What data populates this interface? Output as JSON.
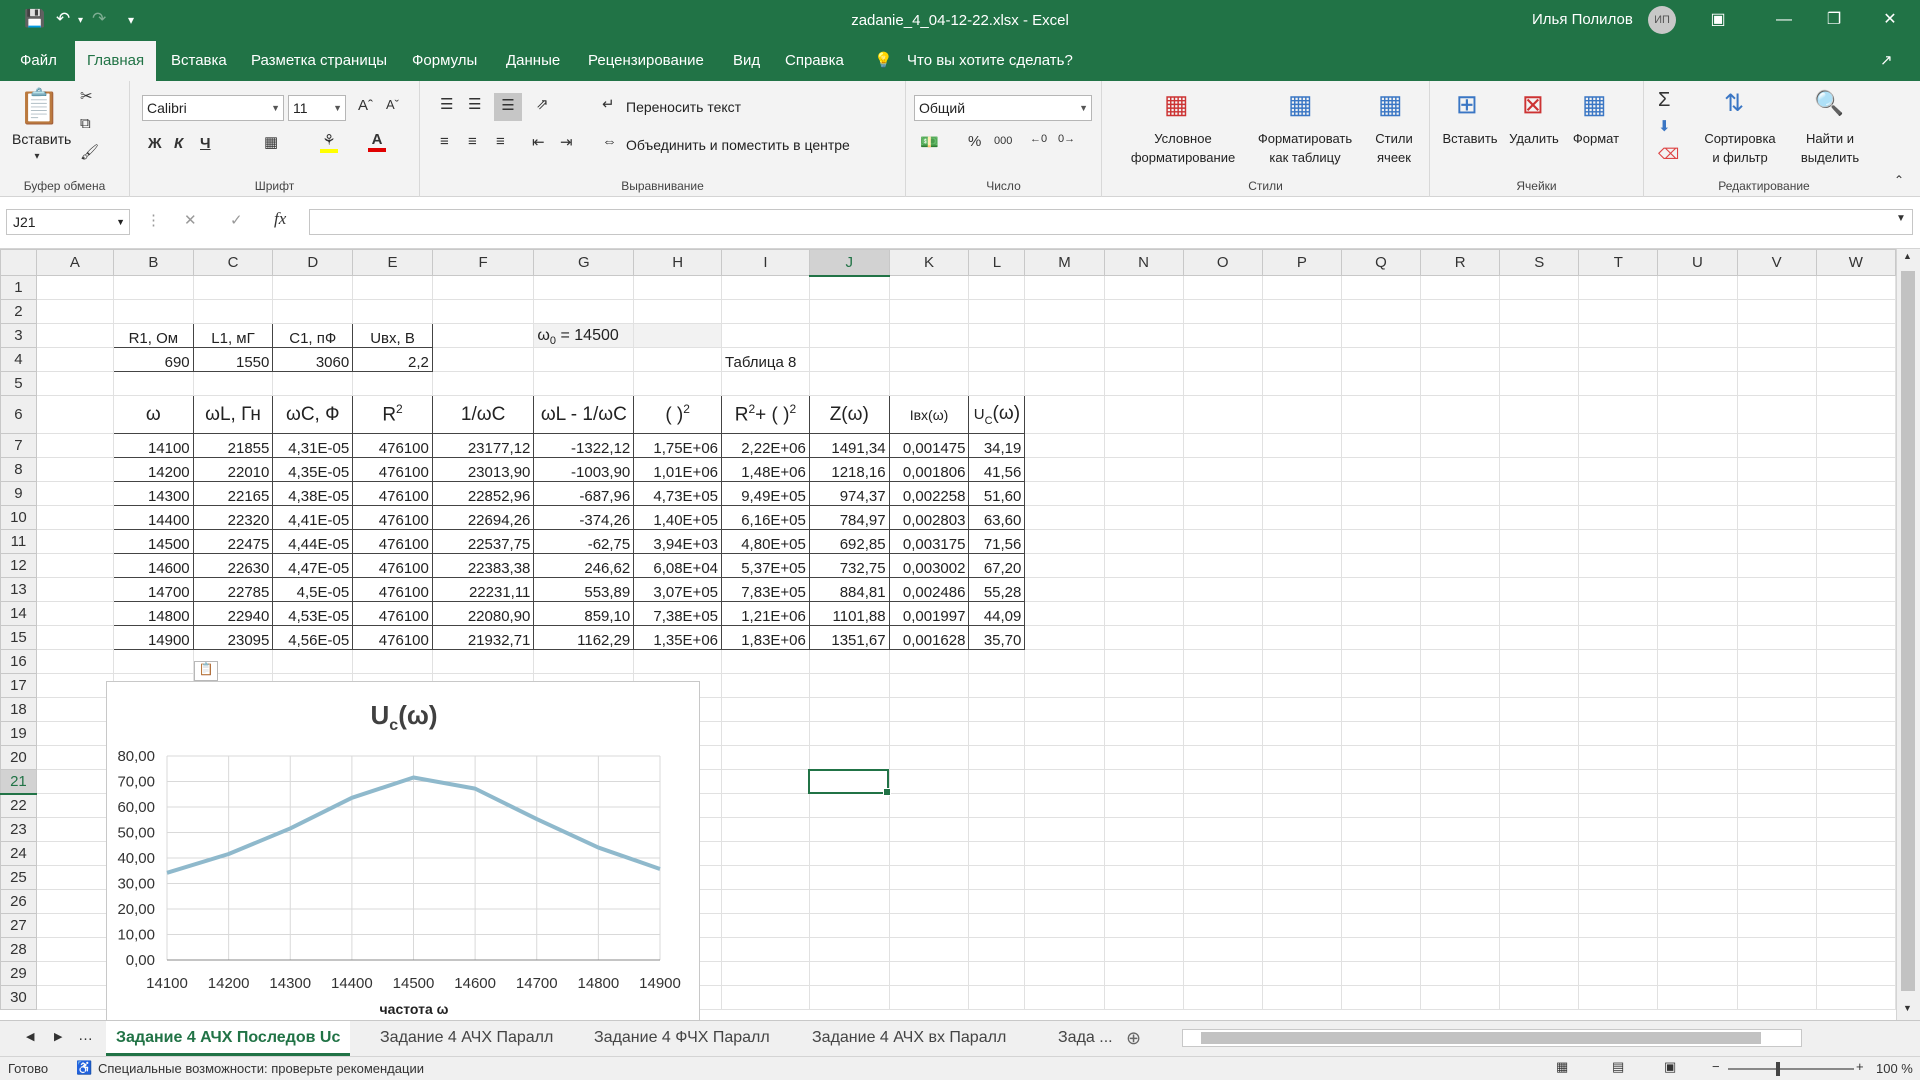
{
  "window": {
    "title": "zadanie_4_04-12-22.xlsx  -  Excel",
    "user_name": "Илья Полилов",
    "user_initials": "ИП"
  },
  "menu": {
    "tabs": [
      "Файл",
      "Главная",
      "Вставка",
      "Разметка страницы",
      "Формулы",
      "Данные",
      "Рецензирование",
      "Вид",
      "Справка"
    ],
    "tell_me": "Что вы хотите сделать?"
  },
  "ribbon": {
    "clipboard": {
      "label": "Буфер обмена",
      "paste": "Вставить"
    },
    "font": {
      "label": "Шрифт",
      "font_name": "Calibri",
      "font_size": "11",
      "bold": "Ж",
      "italic": "К",
      "underline": "Ч"
    },
    "alignment": {
      "label": "Выравнивание",
      "wrap_text": "Переносить текст",
      "merge_center": "Объединить и поместить в центре"
    },
    "number": {
      "label": "Число",
      "format": "Общий",
      "percent": "%",
      "thousands": "000"
    },
    "styles": {
      "label": "Стили",
      "conditional": "Условное\nформатирование",
      "format_table": "Форматировать\nкак таблицу",
      "cell_styles": "Стили\nячеек"
    },
    "cells": {
      "label": "Ячейки",
      "insert": "Вставить",
      "delete": "Удалить",
      "format": "Формат"
    },
    "editing": {
      "label": "Редактирование",
      "sort_filter": "Сортировка\nи фильтр",
      "find_select": "Найти и\nвыделить"
    }
  },
  "formula_bar": {
    "name_box": "J21",
    "formula": ""
  },
  "columns": [
    "A",
    "B",
    "C",
    "D",
    "E",
    "F",
    "G",
    "H",
    "I",
    "J",
    "K",
    "L",
    "M",
    "N",
    "O",
    "P",
    "Q",
    "R",
    "S",
    "T",
    "U",
    "V",
    "W"
  ],
  "rows": [
    "1",
    "2",
    "3",
    "4",
    "5",
    "6",
    "7",
    "8",
    "9",
    "10",
    "11",
    "12",
    "13",
    "14",
    "15",
    "16",
    "17",
    "18",
    "19",
    "20",
    "21",
    "22",
    "23",
    "24",
    "25",
    "26",
    "27",
    "28",
    "29",
    "30"
  ],
  "params_table": {
    "headers": [
      "R1,  Ом",
      "L1, мГ",
      "C1, пФ",
      "Uвх, В"
    ],
    "values": [
      "690",
      "1550",
      "3060",
      "2,2"
    ]
  },
  "omega0_label": "ω",
  "omega0_sub": "0",
  "omega0_value": " = 14500",
  "table_caption": "Таблица 8",
  "main_table": {
    "headers": [
      "ω",
      "ωL, Гн",
      "ωC, Ф",
      "R",
      "1/ωC",
      "ωL - 1/ωC",
      "(    )",
      "R",
      "Z(ω)",
      "Iвх(ω)",
      "U"
    ],
    "header_sups": {
      "R2": "2",
      "paren": "2",
      "R2b": "2",
      "Rplus": "+ (  )",
      "Uc_sub": "C",
      "Uc_tail": "(ω)"
    },
    "rows": [
      [
        "14100",
        "21855",
        "4,31E-05",
        "476100",
        "23177,12",
        "-1322,12",
        "1,75E+06",
        "2,22E+06",
        "1491,34",
        "0,001475",
        "34,19"
      ],
      [
        "14200",
        "22010",
        "4,35E-05",
        "476100",
        "23013,90",
        "-1003,90",
        "1,01E+06",
        "1,48E+06",
        "1218,16",
        "0,001806",
        "41,56"
      ],
      [
        "14300",
        "22165",
        "4,38E-05",
        "476100",
        "22852,96",
        "-687,96",
        "4,73E+05",
        "9,49E+05",
        "974,37",
        "0,002258",
        "51,60"
      ],
      [
        "14400",
        "22320",
        "4,41E-05",
        "476100",
        "22694,26",
        "-374,26",
        "1,40E+05",
        "6,16E+05",
        "784,97",
        "0,002803",
        "63,60"
      ],
      [
        "14500",
        "22475",
        "4,44E-05",
        "476100",
        "22537,75",
        "-62,75",
        "3,94E+03",
        "4,80E+05",
        "692,85",
        "0,003175",
        "71,56"
      ],
      [
        "14600",
        "22630",
        "4,47E-05",
        "476100",
        "22383,38",
        "246,62",
        "6,08E+04",
        "5,37E+05",
        "732,75",
        "0,003002",
        "67,20"
      ],
      [
        "14700",
        "22785",
        "4,5E-05",
        "476100",
        "22231,11",
        "553,89",
        "3,07E+05",
        "7,83E+05",
        "884,81",
        "0,002486",
        "55,28"
      ],
      [
        "14800",
        "22940",
        "4,53E-05",
        "476100",
        "22080,90",
        "859,10",
        "7,38E+05",
        "1,21E+06",
        "1101,88",
        "0,001997",
        "44,09"
      ],
      [
        "14900",
        "23095",
        "4,56E-05",
        "476100",
        "21932,71",
        "1162,29",
        "1,35E+06",
        "1,83E+06",
        "1351,67",
        "0,001628",
        "35,70"
      ]
    ]
  },
  "chart_data": {
    "type": "line",
    "title": "U",
    "title_sub": "c",
    "title_tail": "(ω)",
    "xlabel": "частота ω",
    "ylabel": "",
    "categories": [
      "14100",
      "14200",
      "14300",
      "14400",
      "14500",
      "14600",
      "14700",
      "14800",
      "14900"
    ],
    "series": [
      {
        "values": [
          34.19,
          41.56,
          51.6,
          63.6,
          71.56,
          67.2,
          55.28,
          44.09,
          35.7
        ]
      }
    ],
    "ylim": [
      0,
      80
    ],
    "yticks": [
      "0,00",
      "10,00",
      "20,00",
      "30,00",
      "40,00",
      "50,00",
      "60,00",
      "70,00",
      "80,00"
    ],
    "grid": true,
    "color": "#8fb9cc"
  },
  "sheet_tabs": [
    "Задание 4 АЧХ Последов Uc",
    "Задание 4 АЧХ Паралл",
    "Задание 4 ФЧХ Паралл",
    "Задание 4 АЧХ вх Паралл",
    "Зада ..."
  ],
  "status": {
    "ready": "Готово",
    "accessibility": "Специальные возможности: проверьте рекомендации",
    "zoom": "100 %"
  },
  "colors": {
    "brand": "#217346",
    "ribbon_bg": "#f3f3f3"
  }
}
